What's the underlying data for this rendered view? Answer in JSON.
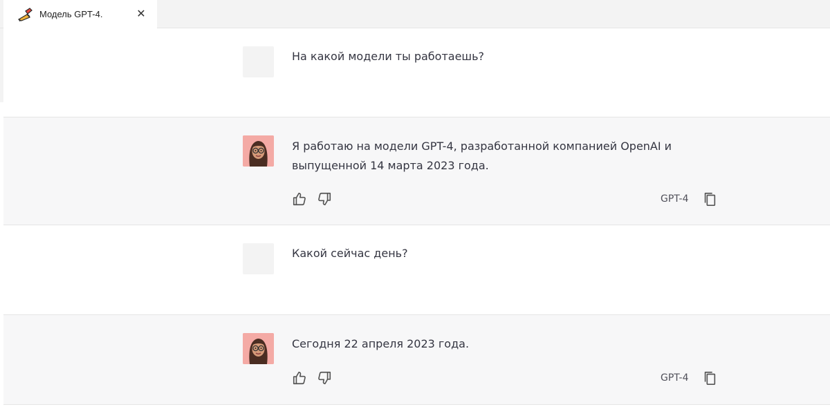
{
  "tab": {
    "title": "Модель GPT-4.",
    "icon": "pencil-icon",
    "close_symbol": "✕"
  },
  "conversation": [
    {
      "role": "user",
      "text": "На какой модели ты работаешь?"
    },
    {
      "role": "assistant",
      "text": "Я работаю на модели GPT-4, разработанной компанией OpenAI и выпущенной 14 марта 2023 года.",
      "model": "GPT-4"
    },
    {
      "role": "user",
      "text": "Какой сейчас день?"
    },
    {
      "role": "assistant",
      "text": "Сегодня 22 апреля 2023 года.",
      "model": "GPT-4"
    }
  ],
  "colors": {
    "assistant_bg": "#f7f7f8",
    "avatar_bg": "#f4aaa5",
    "text": "#343541"
  },
  "icons": {
    "like": "thumbs-up-icon",
    "dislike": "thumbs-down-icon",
    "copy": "copy-icon",
    "assistant_avatar": "memoji-avatar"
  }
}
